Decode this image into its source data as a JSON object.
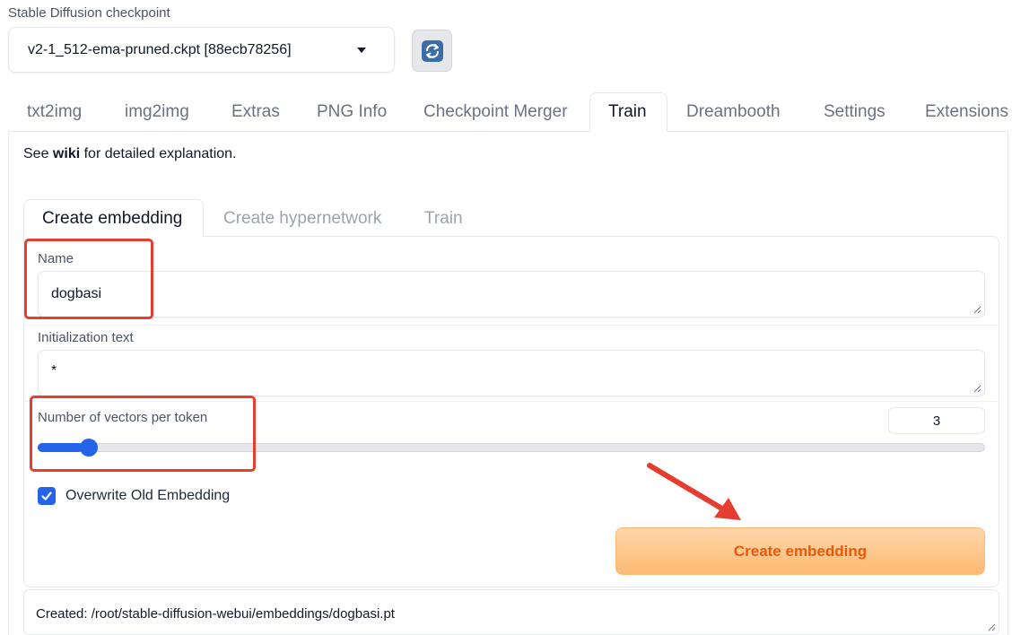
{
  "checkpoint": {
    "label": "Stable Diffusion checkpoint",
    "selected": "v2-1_512-ema-pruned.ckpt [88ecb78256]",
    "refresh_icon": "refresh-icon"
  },
  "main_tabs": [
    {
      "label": "txt2img",
      "active": false
    },
    {
      "label": "img2img",
      "active": false
    },
    {
      "label": "Extras",
      "active": false
    },
    {
      "label": "PNG Info",
      "active": false
    },
    {
      "label": "Checkpoint Merger",
      "active": false
    },
    {
      "label": "Train",
      "active": true
    },
    {
      "label": "Dreambooth",
      "active": false
    },
    {
      "label": "Settings",
      "active": false
    },
    {
      "label": "Extensions",
      "active": false
    }
  ],
  "train": {
    "note_prefix": "See ",
    "note_link": "wiki",
    "note_suffix": " for detailed explanation.",
    "sub_tabs": [
      {
        "label": "Create embedding",
        "active": true
      },
      {
        "label": "Create hypernetwork",
        "active": false
      },
      {
        "label": "Train",
        "active": false
      }
    ],
    "name_label": "Name",
    "name_value": "dogbasi",
    "init_label": "Initialization text",
    "init_value": "*",
    "vectors_label": "Number of vectors per token",
    "vectors_value": "3",
    "vectors_slider_fraction": 0.035,
    "overwrite_label": "Overwrite Old Embedding",
    "overwrite_checked": true,
    "create_button": "Create embedding",
    "output": "Created: /root/stable-diffusion-webui/embeddings/dogbasi.pt"
  },
  "colors": {
    "accent": "#2563eb",
    "button_text": "#ea580c",
    "annotation": "#e53e30"
  }
}
